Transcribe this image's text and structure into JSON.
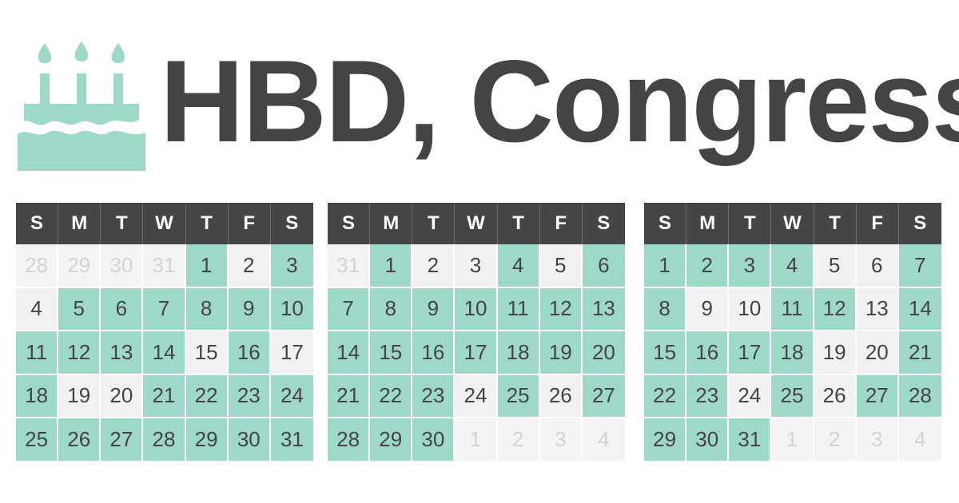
{
  "title": "HBD, Congress",
  "icon": "birthday-cake-icon",
  "colors": {
    "title": "#444444",
    "cake": "#9ed8c9",
    "header_bg": "#454545",
    "highlight": "#9ed8c9",
    "plain": "#f1f1f1",
    "other_month_text": "#d3d3d3"
  },
  "weekdays": [
    "S",
    "M",
    "T",
    "W",
    "T",
    "F",
    "S"
  ],
  "calendars": [
    {
      "days": [
        {
          "d": "28",
          "s": "o"
        },
        {
          "d": "29",
          "s": "o"
        },
        {
          "d": "30",
          "s": "o"
        },
        {
          "d": "31",
          "s": "o"
        },
        {
          "d": "1",
          "s": "g"
        },
        {
          "d": "2",
          "s": "w"
        },
        {
          "d": "3",
          "s": "g"
        },
        {
          "d": "4",
          "s": "w"
        },
        {
          "d": "5",
          "s": "g"
        },
        {
          "d": "6",
          "s": "g"
        },
        {
          "d": "7",
          "s": "g"
        },
        {
          "d": "8",
          "s": "g"
        },
        {
          "d": "9",
          "s": "g"
        },
        {
          "d": "10",
          "s": "g"
        },
        {
          "d": "11",
          "s": "g"
        },
        {
          "d": "12",
          "s": "g"
        },
        {
          "d": "13",
          "s": "g"
        },
        {
          "d": "14",
          "s": "g"
        },
        {
          "d": "15",
          "s": "w"
        },
        {
          "d": "16",
          "s": "g"
        },
        {
          "d": "17",
          "s": "w"
        },
        {
          "d": "18",
          "s": "g"
        },
        {
          "d": "19",
          "s": "w"
        },
        {
          "d": "20",
          "s": "w"
        },
        {
          "d": "21",
          "s": "g"
        },
        {
          "d": "22",
          "s": "g"
        },
        {
          "d": "23",
          "s": "g"
        },
        {
          "d": "24",
          "s": "g"
        },
        {
          "d": "25",
          "s": "g"
        },
        {
          "d": "26",
          "s": "g"
        },
        {
          "d": "27",
          "s": "g"
        },
        {
          "d": "28",
          "s": "g"
        },
        {
          "d": "29",
          "s": "g"
        },
        {
          "d": "30",
          "s": "g"
        },
        {
          "d": "31",
          "s": "g"
        }
      ]
    },
    {
      "days": [
        {
          "d": "31",
          "s": "o"
        },
        {
          "d": "1",
          "s": "g"
        },
        {
          "d": "2",
          "s": "w"
        },
        {
          "d": "3",
          "s": "w"
        },
        {
          "d": "4",
          "s": "g"
        },
        {
          "d": "5",
          "s": "w"
        },
        {
          "d": "6",
          "s": "g"
        },
        {
          "d": "7",
          "s": "g"
        },
        {
          "d": "8",
          "s": "g"
        },
        {
          "d": "9",
          "s": "g"
        },
        {
          "d": "10",
          "s": "g"
        },
        {
          "d": "11",
          "s": "g"
        },
        {
          "d": "12",
          "s": "g"
        },
        {
          "d": "13",
          "s": "g"
        },
        {
          "d": "14",
          "s": "g"
        },
        {
          "d": "15",
          "s": "g"
        },
        {
          "d": "16",
          "s": "g"
        },
        {
          "d": "17",
          "s": "g"
        },
        {
          "d": "18",
          "s": "g"
        },
        {
          "d": "19",
          "s": "g"
        },
        {
          "d": "20",
          "s": "g"
        },
        {
          "d": "21",
          "s": "g"
        },
        {
          "d": "22",
          "s": "g"
        },
        {
          "d": "23",
          "s": "g"
        },
        {
          "d": "24",
          "s": "w"
        },
        {
          "d": "25",
          "s": "g"
        },
        {
          "d": "26",
          "s": "w"
        },
        {
          "d": "27",
          "s": "g"
        },
        {
          "d": "28",
          "s": "g"
        },
        {
          "d": "29",
          "s": "g"
        },
        {
          "d": "30",
          "s": "g"
        },
        {
          "d": "1",
          "s": "o"
        },
        {
          "d": "2",
          "s": "o"
        },
        {
          "d": "3",
          "s": "o"
        },
        {
          "d": "4",
          "s": "o"
        }
      ]
    },
    {
      "days": [
        {
          "d": "1",
          "s": "g"
        },
        {
          "d": "2",
          "s": "g"
        },
        {
          "d": "3",
          "s": "g"
        },
        {
          "d": "4",
          "s": "g"
        },
        {
          "d": "5",
          "s": "w"
        },
        {
          "d": "6",
          "s": "w"
        },
        {
          "d": "7",
          "s": "g"
        },
        {
          "d": "8",
          "s": "g"
        },
        {
          "d": "9",
          "s": "w"
        },
        {
          "d": "10",
          "s": "w"
        },
        {
          "d": "11",
          "s": "g"
        },
        {
          "d": "12",
          "s": "g"
        },
        {
          "d": "13",
          "s": "w"
        },
        {
          "d": "14",
          "s": "g"
        },
        {
          "d": "15",
          "s": "g"
        },
        {
          "d": "16",
          "s": "g"
        },
        {
          "d": "17",
          "s": "g"
        },
        {
          "d": "18",
          "s": "g"
        },
        {
          "d": "19",
          "s": "w"
        },
        {
          "d": "20",
          "s": "w"
        },
        {
          "d": "21",
          "s": "g"
        },
        {
          "d": "22",
          "s": "g"
        },
        {
          "d": "23",
          "s": "g"
        },
        {
          "d": "24",
          "s": "w"
        },
        {
          "d": "25",
          "s": "g"
        },
        {
          "d": "26",
          "s": "w"
        },
        {
          "d": "27",
          "s": "g"
        },
        {
          "d": "28",
          "s": "g"
        },
        {
          "d": "29",
          "s": "g"
        },
        {
          "d": "30",
          "s": "g"
        },
        {
          "d": "31",
          "s": "g"
        },
        {
          "d": "1",
          "s": "o"
        },
        {
          "d": "2",
          "s": "o"
        },
        {
          "d": "3",
          "s": "o"
        },
        {
          "d": "4",
          "s": "o"
        }
      ]
    }
  ]
}
